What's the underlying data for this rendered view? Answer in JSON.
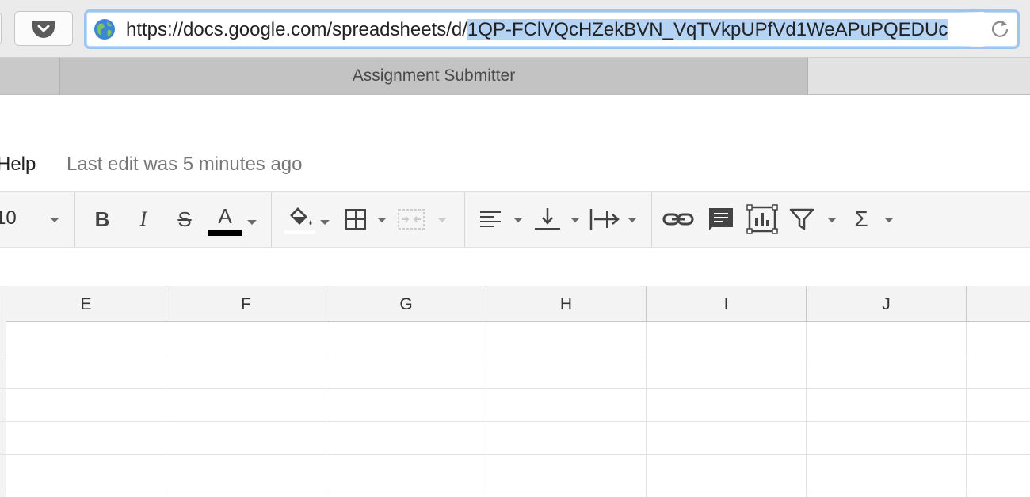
{
  "browser": {
    "url_prefix": "https://docs.google.com/spreadsheets/d/",
    "url_selected": "1QP-FClVQcHZekBVN_VqTVkpUPfVd1WeAPuPQEDUc",
    "tab_title": "Assignment Submitter"
  },
  "menu": {
    "help_label": "Help",
    "last_edit": "Last edit was 5 minutes ago"
  },
  "toolbar": {
    "font_size": "10",
    "bold_glyph": "B",
    "italic_glyph": "I",
    "strike_glyph": "S",
    "text_color_glyph": "A",
    "sum_glyph": "Σ",
    "text_color": "#000000"
  },
  "grid": {
    "columns": [
      "E",
      "F",
      "G",
      "H",
      "I",
      "J"
    ]
  }
}
